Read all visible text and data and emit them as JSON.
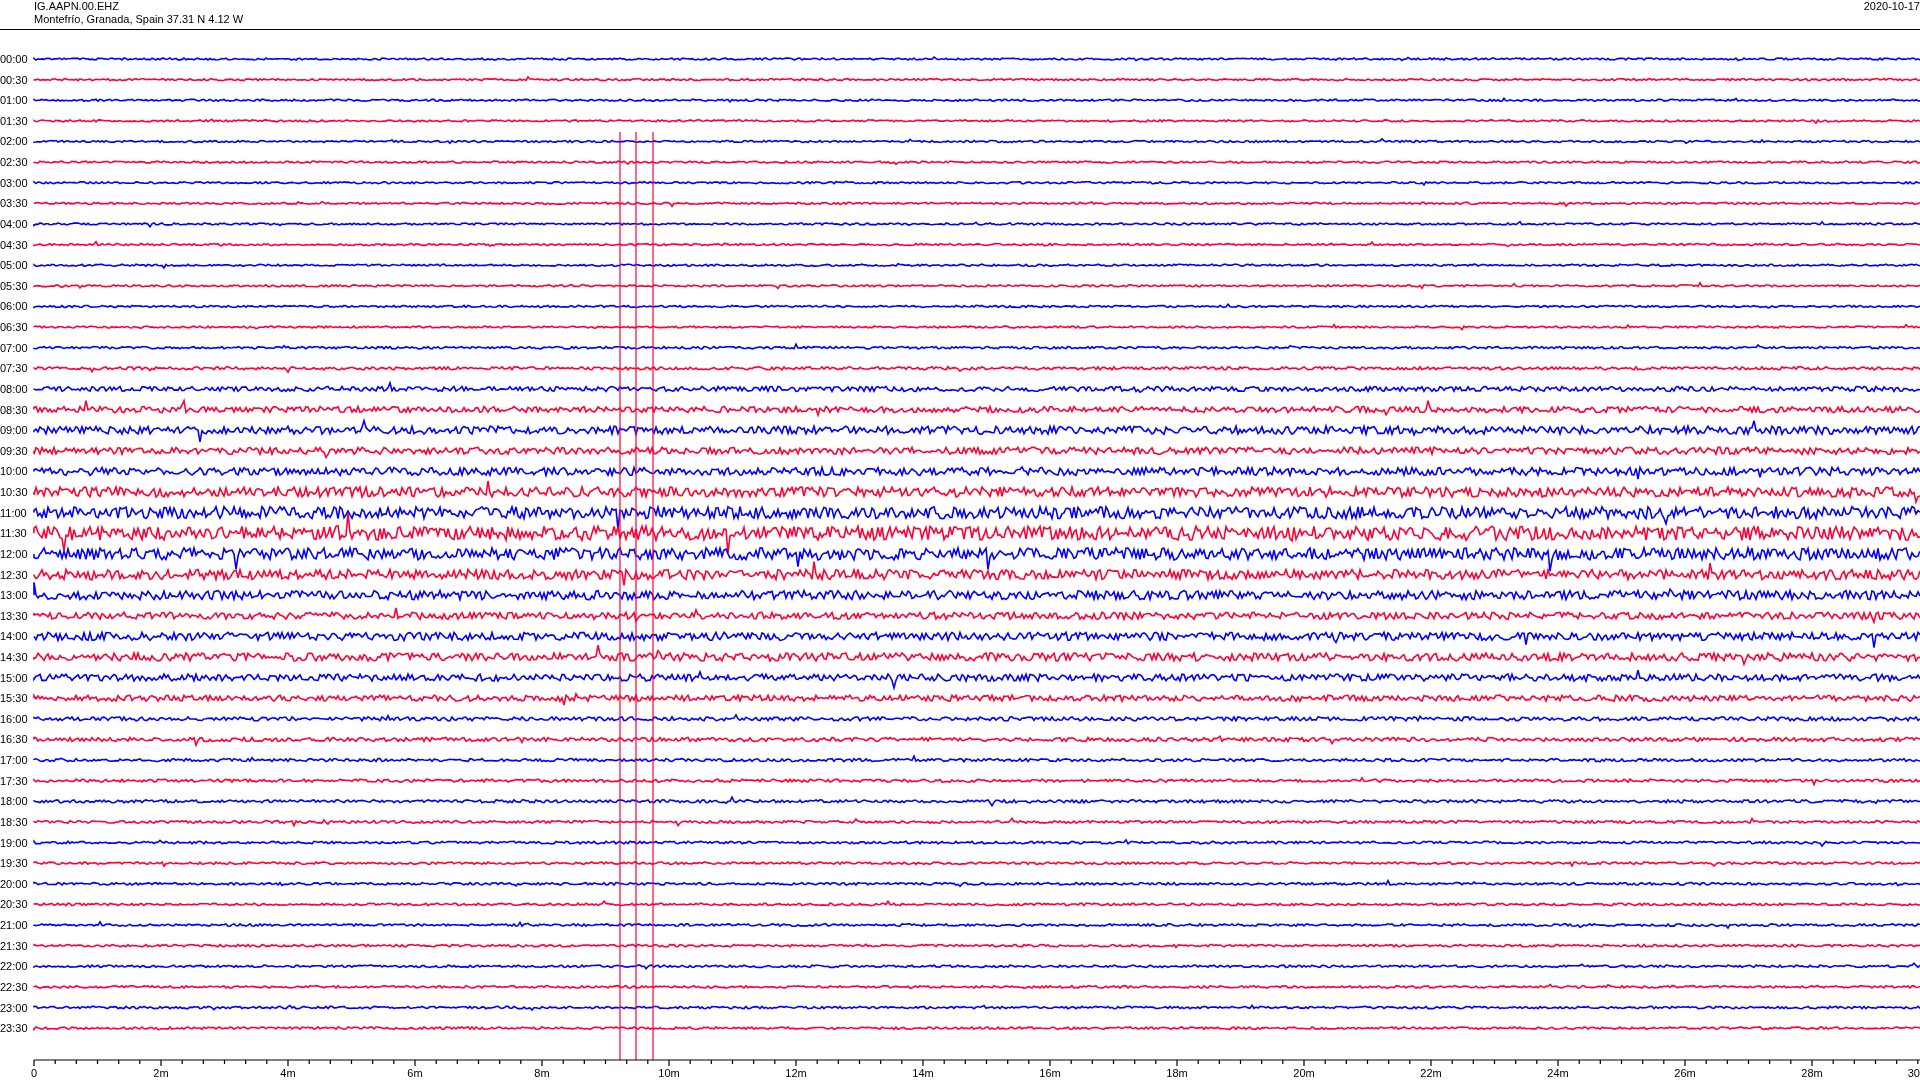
{
  "header": {
    "station": "IG.AAPN.00.EHZ",
    "location": "Montefrío, Granada, Spain  37.31 N 4.12 W",
    "date": "2020-10-17"
  },
  "rows": [
    {
      "time": "00:00",
      "color": "#0000ff"
    },
    {
      "time": "00:30",
      "color": "#ff0033"
    },
    {
      "time": "01:00",
      "color": "#0000ff"
    },
    {
      "time": "01:30",
      "color": "#ff0033"
    },
    {
      "time": "02:00",
      "color": "#0000ff"
    },
    {
      "time": "02:30",
      "color": "#ff0033"
    },
    {
      "time": "03:00",
      "color": "#0000ff"
    },
    {
      "time": "03:30",
      "color": "#ff0033"
    },
    {
      "time": "04:00",
      "color": "#0000ff"
    },
    {
      "time": "04:30",
      "color": "#ff0033"
    },
    {
      "time": "05:00",
      "color": "#0000ff"
    },
    {
      "time": "05:30",
      "color": "#ff0033"
    },
    {
      "time": "06:00",
      "color": "#0000ff"
    },
    {
      "time": "06:30",
      "color": "#ff0033"
    },
    {
      "time": "07:00",
      "color": "#0000ff"
    },
    {
      "time": "07:30",
      "color": "#ff0033"
    },
    {
      "time": "08:00",
      "color": "#0000ff"
    },
    {
      "time": "08:30",
      "color": "#ff0033"
    },
    {
      "time": "09:00",
      "color": "#0000ff"
    },
    {
      "time": "09:30",
      "color": "#ff0033"
    },
    {
      "time": "10:00",
      "color": "#0000ff"
    },
    {
      "time": "10:30",
      "color": "#ff0033"
    },
    {
      "time": "11:00",
      "color": "#0000ff"
    },
    {
      "time": "11:30",
      "color": "#ff0033"
    },
    {
      "time": "12:00",
      "color": "#0000ff"
    },
    {
      "time": "12:30",
      "color": "#ff0033"
    },
    {
      "time": "13:00",
      "color": "#0000ff"
    },
    {
      "time": "13:30",
      "color": "#ff0033"
    },
    {
      "time": "14:00",
      "color": "#0000ff"
    },
    {
      "time": "14:30",
      "color": "#ff0033"
    },
    {
      "time": "15:00",
      "color": "#0000ff"
    },
    {
      "time": "15:30",
      "color": "#ff0033"
    },
    {
      "time": "16:00",
      "color": "#0000ff"
    },
    {
      "time": "16:30",
      "color": "#ff0033"
    },
    {
      "time": "17:00",
      "color": "#0000ff"
    },
    {
      "time": "17:30",
      "color": "#ff0033"
    },
    {
      "time": "18:00",
      "color": "#0000ff"
    },
    {
      "time": "18:30",
      "color": "#ff0033"
    },
    {
      "time": "19:00",
      "color": "#0000ff"
    },
    {
      "time": "19:30",
      "color": "#ff0033"
    },
    {
      "time": "20:00",
      "color": "#0000ff"
    },
    {
      "time": "20:30",
      "color": "#ff0033"
    },
    {
      "time": "21:00",
      "color": "#0000ff"
    },
    {
      "time": "21:30",
      "color": "#ff0033"
    },
    {
      "time": "22:00",
      "color": "#0000ff"
    },
    {
      "time": "22:30",
      "color": "#ff0033"
    },
    {
      "time": "23:00",
      "color": "#0000ff"
    },
    {
      "time": "23:30",
      "color": "#ff0033"
    }
  ],
  "axis": {
    "ticks": [
      "0",
      "2m",
      "4m",
      "6m",
      "8m",
      "10m",
      "12m",
      "14m",
      "16m",
      "18m",
      "20m",
      "22m",
      "24m",
      "26m",
      "28m",
      "30"
    ]
  }
}
